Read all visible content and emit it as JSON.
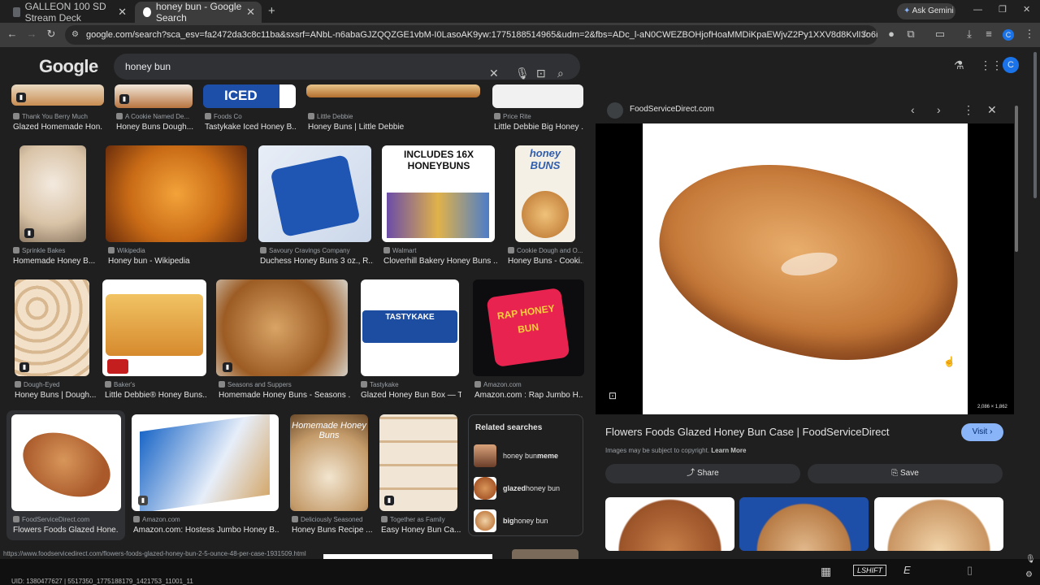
{
  "tabs": [
    {
      "title": "GALLEON 100 SD Stream Deck"
    },
    {
      "title": "honey bun - Google Search"
    }
  ],
  "address": {
    "url": "google.com/search?sca_esv=fa2472da3c8c11ba&sxsrf=ANbL-n6abaGJZQQZGE1vbM-I0LasoAK9yw:1775188514965&udm=2&fbs=ADc_l-aN0CWEZBOHjofHoaMMDiKpaEWjvZ2Py1XXV8d8KvlI3o6iwGk6lv1tRbZIBNlVs-5-bUj3iBl-U..."
  },
  "gemini": {
    "label": "Ask Gemini"
  },
  "google": {
    "logo": "Google",
    "query": "honey bun"
  },
  "profile": {
    "initial": "C"
  },
  "top_row": [
    {
      "source": "Thank You Berry Much",
      "caption": "Glazed Homemade Hon..."
    },
    {
      "source": "A Cookie Named De...",
      "caption": "Honey Buns Dough..."
    },
    {
      "source": "Foods Co",
      "caption": "Tastykake Iced Honey B...",
      "thumb_text": "ICED"
    },
    {
      "source": "Little Debbie",
      "caption": "Honey Buns | Little Debbie"
    },
    {
      "source": "Price Rite",
      "caption": "Little Debbie Big Honey ..."
    }
  ],
  "row2": [
    {
      "source": "Sprinkle Bakes",
      "caption": "Homemade Honey B..."
    },
    {
      "source": "Wikipedia",
      "caption": "Honey bun - Wikipedia"
    },
    {
      "source": "Savoury Cravings Company",
      "caption": "Duchess Honey Buns 3 oz., R..."
    },
    {
      "source": "Walmart",
      "caption": "Cloverhill Bakery Honey Buns ...",
      "thumb_text": "INCLUDES 16X HONEYBUNS"
    },
    {
      "source": "Cookie Dough and O...",
      "caption": "Honey Buns - Cooki...",
      "thumb_text": "honey BUNS"
    }
  ],
  "row3": [
    {
      "source": "Dough-Eyed",
      "caption": "Honey Buns | Dough..."
    },
    {
      "source": "Baker's",
      "caption": "Little Debbie® Honey Buns..."
    },
    {
      "source": "Seasons and Suppers",
      "caption": "Homemade Honey Buns - Seasons ..."
    },
    {
      "source": "Tastykake",
      "caption": "Glazed Honey Bun Box — T...",
      "thumb_text": "TASTYKAKE"
    },
    {
      "source": "Amazon.com",
      "caption": "Amazon.com : Rap Jumbo H...",
      "thumb_text": "RAP HONEY BUN"
    }
  ],
  "row4": [
    {
      "source": "FoodServiceDirect.com",
      "caption": "Flowers Foods Glazed Hone..."
    },
    {
      "source": "Amazon.com",
      "caption": "Amazon.com: Hostess Jumbo Honey B..."
    },
    {
      "source": "Deliciously Seasoned",
      "caption": "Honey Buns Recipe ...",
      "thumb_text": "Homemade Honey Buns"
    },
    {
      "source": "Together as Family",
      "caption": "Easy Honey Bun Ca..."
    }
  ],
  "related": {
    "title": "Related searches",
    "items": [
      {
        "bold_prefix": "",
        "text": "honey bun ",
        "bold_suffix": "meme"
      },
      {
        "bold_prefix": "glazed",
        "text": " honey bun",
        "bold_suffix": ""
      },
      {
        "bold_prefix": "big",
        "text": " honey bun",
        "bold_suffix": ""
      }
    ]
  },
  "preview": {
    "site": "FoodServiceDirect.com",
    "dimensions": "2,086 × 1,862",
    "title": "Flowers Foods Glazed Honey Bun Case | FoodServiceDirect",
    "visit": "Visit",
    "copyright": "Images may be subject to copyright.",
    "learn_more": "Learn More",
    "share": "Share",
    "save": "Save"
  },
  "status": {
    "url": "https://www.foodservicedirect.com/flowers-foods-glazed-honey-bun-2-5-ounce-48-per-case-1931509.html",
    "uid": "UID: 1380477627 | 5517350_1775188179_1421753_11001_11"
  },
  "taskbar": {
    "lshift": "LSHIFT"
  },
  "colors": {
    "accent": "#8ab4f8",
    "visit_bg": "#8ab4f8",
    "surface": "#303134",
    "background": "#1f1f1f"
  }
}
